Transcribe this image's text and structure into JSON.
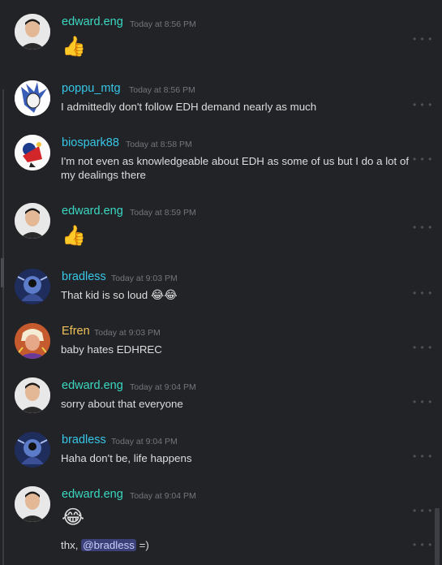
{
  "colors": {
    "edward": "#3ad8c2",
    "poppu": "#37c6e8",
    "biospark": "#37c6e8",
    "bradless": "#37c6e8",
    "efren": "#f0c35a"
  },
  "messages": [
    {
      "user": "edward.eng",
      "time": "Today at 8:56 PM",
      "emoji": "👍",
      "avatar": "person-avatar"
    },
    {
      "user": "poppu_mtg",
      "time": "Today at 8:56 PM",
      "text": "I admittedly don't follow EDH demand nearly as much",
      "avatar": "anime-avatar"
    },
    {
      "user": "biospark88",
      "time": "Today at 8:58 PM",
      "text": "I'm not even as knowledgeable about EDH as some of us but I do a lot of my dealings there",
      "avatar": "cartoon-avatar"
    },
    {
      "user": "edward.eng",
      "time": "Today at 8:59 PM",
      "emoji": "👍",
      "avatar": "person-avatar"
    },
    {
      "user": "bradless",
      "time": "Today at 9:03 PM",
      "text": "That kid is so loud",
      "emoji_inline": "😂😂",
      "avatar": "blue-art-avatar"
    },
    {
      "user": "Efren",
      "time": "Today at 9:03 PM",
      "text": "baby hates EDHREC",
      "avatar": "wrestler-avatar"
    },
    {
      "user": "edward.eng",
      "time": "Today at 9:04 PM",
      "text": "sorry about that everyone",
      "avatar": "person-avatar"
    },
    {
      "user": "bradless",
      "time": "Today at 9:04 PM",
      "text": "Haha don't be, life happens",
      "avatar": "blue-art-avatar"
    },
    {
      "user": "edward.eng",
      "time": "Today at 9:04 PM",
      "emoji": "😂",
      "followup_prefix": "thx,",
      "followup_mention": "@bradless",
      "followup_suffix": "=)",
      "avatar": "person-avatar"
    }
  ],
  "more_glyph": "• • •"
}
